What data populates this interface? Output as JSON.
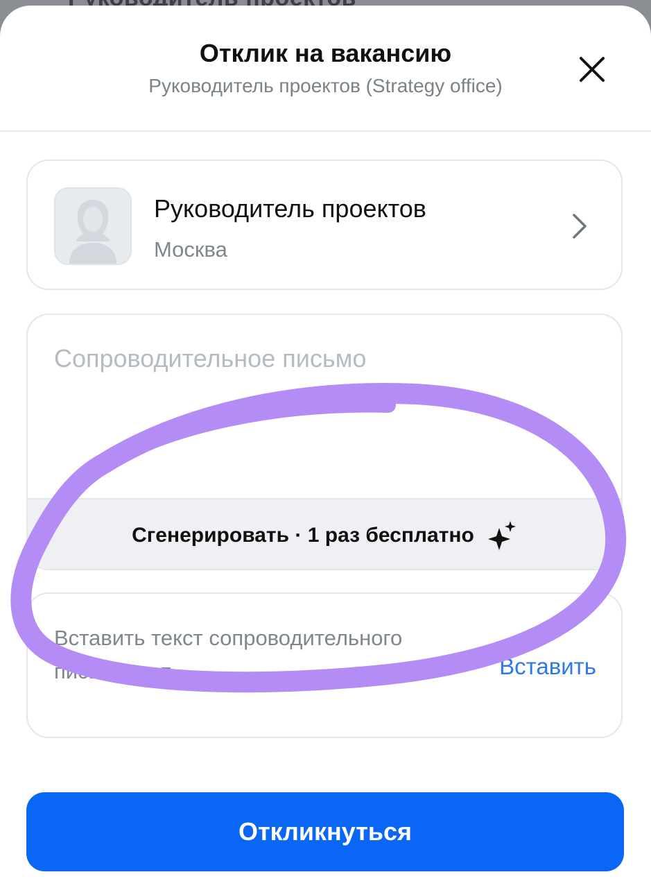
{
  "backdrop": {
    "title": "Руководитель проектов"
  },
  "header": {
    "title": "Отклик на вакансию",
    "subtitle": "Руководитель проектов (Strategy office)",
    "close_icon": "close-icon"
  },
  "vacancy": {
    "title": "Руководитель проектов",
    "city": "Москва",
    "avatar_icon": "person-silhouette-icon",
    "chevron_icon": "chevron-right-icon"
  },
  "cover_letter": {
    "placeholder": "Сопроводительное письмо",
    "generate_label": "Сгенерировать · 1 раз бесплатно",
    "generate_icon": "sparkle-icon"
  },
  "paste": {
    "text": "Вставить текст сопроводительного письма из п",
    "link_label": "Вставить"
  },
  "submit": {
    "label": "Откликнуться"
  },
  "colors": {
    "accent": "#0a66f5",
    "link": "#2f79e8",
    "annotation_stroke": "#b48cf5"
  }
}
